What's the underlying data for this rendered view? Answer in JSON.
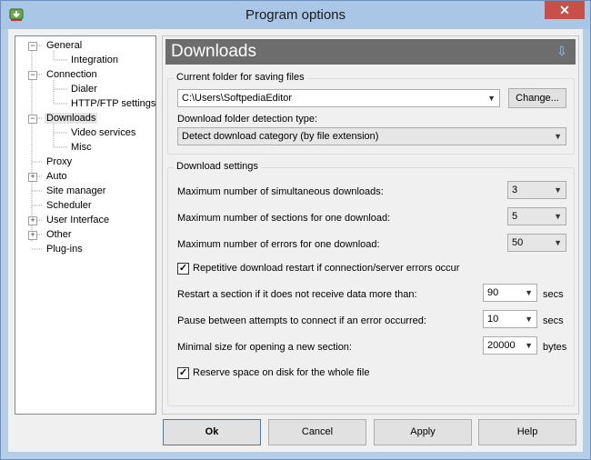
{
  "window": {
    "title": "Program options",
    "close_label": "✕"
  },
  "tree": {
    "items": [
      {
        "label": "General"
      },
      {
        "label": "Integration"
      },
      {
        "label": "Connection"
      },
      {
        "label": "Dialer"
      },
      {
        "label": "HTTP/FTP settings"
      },
      {
        "label": "Downloads"
      },
      {
        "label": "Video services"
      },
      {
        "label": "Misc"
      },
      {
        "label": "Proxy"
      },
      {
        "label": "Auto"
      },
      {
        "label": "Site manager"
      },
      {
        "label": "Scheduler"
      },
      {
        "label": "User Interface"
      },
      {
        "label": "Other"
      },
      {
        "label": "Plug-ins"
      }
    ]
  },
  "panel": {
    "header": "Downloads",
    "folder_group": {
      "title": "Current folder for saving files",
      "path_value": "C:\\Users\\SoftpediaEditor",
      "change_button": "Change...",
      "detection_label": "Download folder detection type:",
      "detection_value": "Detect download category (by file extension)"
    },
    "settings_group": {
      "title": "Download settings",
      "max_simultaneous_label": "Maximum number of simultaneous downloads:",
      "max_simultaneous_value": "3",
      "max_sections_label": "Maximum number of sections for one download:",
      "max_sections_value": "5",
      "max_errors_label": "Maximum number of errors for one download:",
      "max_errors_value": "50",
      "repetitive_restart_label": "Repetitive download restart if connection/server errors occur",
      "restart_section_label": "Restart a section if it does not receive data more than:",
      "restart_section_value": "90",
      "restart_section_unit": "secs",
      "pause_label": "Pause between attempts to connect if an error occurred:",
      "pause_value": "10",
      "pause_unit": "secs",
      "min_size_label": "Minimal size for opening a new section:",
      "min_size_value": "20000",
      "min_size_unit": "bytes",
      "reserve_space_label": "Reserve space on disk for the whole file"
    }
  },
  "buttons": {
    "ok": "Ok",
    "cancel": "Cancel",
    "apply": "Apply",
    "help": "Help"
  },
  "colors": {
    "titlebar": "#aac6e6",
    "header_bg": "#6d6d6d",
    "close": "#c7504a"
  }
}
